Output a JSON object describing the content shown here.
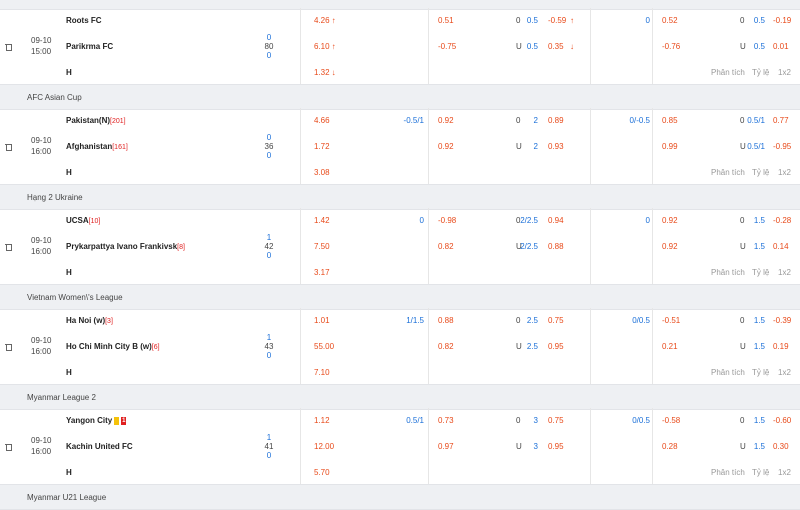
{
  "matches": [
    {
      "league": "",
      "date": "09-10",
      "time": "15:00",
      "home": "Roots FC",
      "home_rank": "",
      "away": "Parikrma FC",
      "away_rank": "",
      "draw": "H",
      "score_top": "0",
      "minute": "80",
      "score_bot": "0",
      "x1": "4.26",
      "x2": "6.10",
      "x3": "1.32",
      "x1_arrow": "↑",
      "x2_arrow": "↑",
      "x3_arrow": "↓",
      "hcap_line": "",
      "hcap1": "0.51",
      "hcap2": "-0.75",
      "ou_h": "0",
      "ou_line_h": "0.5",
      "ou1": "-0.59",
      "ou1_arrow": "↑",
      "ou_a": "U",
      "ou_line_a": "0.5",
      "ou2": "0.35",
      "ou2_arrow": "↓",
      "h1_line": "0",
      "h1a": "0.52",
      "h1b": "-0.76",
      "h1ou_h": "0",
      "h1ou_lh": "0.5",
      "h1ou1": "-0.19",
      "h1ou_a": "U",
      "h1ou_la": "0.5",
      "h1ou2": "0.01",
      "link1": "Phân tích",
      "link2": "Tỷ lệ",
      "link3": "1x2"
    },
    {
      "league": "AFC Asian Cup",
      "date": "09-10",
      "time": "16:00",
      "home": "Pakistan(N)",
      "home_rank": "[201]",
      "away": "Afghanistan",
      "away_rank": "[161]",
      "draw": "H",
      "score_top": "0",
      "minute": "36",
      "score_bot": "0",
      "x1": "4.66",
      "x2": "1.72",
      "x3": "3.08",
      "hcap_line": "-0.5/1",
      "hcap1": "0.92",
      "hcap2": "0.92",
      "ou_h": "0",
      "ou_line_h": "2",
      "ou1": "0.89",
      "ou_a": "U",
      "ou_line_a": "2",
      "ou2": "0.93",
      "h1_line": "0/-0.5",
      "h1a": "0.85",
      "h1b": "0.99",
      "h1ou_h": "0",
      "h1ou_lh": "0.5/1",
      "h1ou1": "0.77",
      "h1ou_a": "U",
      "h1ou_la": "0.5/1",
      "h1ou2": "-0.95",
      "link1": "Phân tích",
      "link2": "Tỷ lệ",
      "link3": "1x2"
    },
    {
      "league": "Hạng 2 Ukraine",
      "date": "09-10",
      "time": "16:00",
      "home": "UCSA",
      "home_rank": "[10]",
      "away": "Prykarpattya Ivano Frankivsk",
      "away_rank": "[8]",
      "draw": "H",
      "score_top": "1",
      "minute": "42",
      "score_bot": "0",
      "x1": "1.42",
      "x2": "7.50",
      "x3": "3.17",
      "hcap_line": "0",
      "hcap1": "-0.98",
      "hcap2": "0.82",
      "ou_h": "0",
      "ou_line_h": "2/2.5",
      "ou1": "0.94",
      "ou_a": "U",
      "ou_line_a": "2/2.5",
      "ou2": "0.88",
      "h1_line": "0",
      "h1a": "0.92",
      "h1b": "0.92",
      "h1ou_h": "0",
      "h1ou_lh": "1.5",
      "h1ou1": "-0.28",
      "h1ou_a": "U",
      "h1ou_la": "1.5",
      "h1ou2": "0.14",
      "link1": "Phân tích",
      "link2": "Tỷ lệ",
      "link3": "1x2"
    },
    {
      "league": "Vietnam Women\\'s League",
      "date": "09-10",
      "time": "16:00",
      "home": "Ha Noi (w)",
      "home_rank": "[3]",
      "away": "Ho Chi Minh City B (w)",
      "away_rank": "[6]",
      "draw": "H",
      "score_top": "1",
      "minute": "43",
      "score_bot": "0",
      "x1": "1.01",
      "x2": "55.00",
      "x3": "7.10",
      "hcap_line": "1/1.5",
      "hcap1": "0.88",
      "hcap2": "0.82",
      "ou_h": "0",
      "ou_line_h": "2.5",
      "ou1": "0.75",
      "ou_a": "U",
      "ou_line_a": "2.5",
      "ou2": "0.95",
      "h1_line": "0/0.5",
      "h1a": "-0.51",
      "h1b": "0.21",
      "h1ou_h": "0",
      "h1ou_lh": "1.5",
      "h1ou1": "-0.39",
      "h1ou_a": "U",
      "h1ou_la": "1.5",
      "h1ou2": "0.19",
      "link1": "Phân tích",
      "link2": "Tỷ lệ",
      "link3": "1x2"
    },
    {
      "league": "Myanmar League 2",
      "date": "09-10",
      "time": "16:00",
      "home": "Yangon City",
      "home_rank": "",
      "home_card": "1",
      "away": "Kachin United FC",
      "away_rank": "",
      "draw": "H",
      "score_top": "1",
      "minute": "41",
      "score_bot": "0",
      "x1": "1.12",
      "x2": "12.00",
      "x3": "5.70",
      "hcap_line": "0.5/1",
      "hcap1": "0.73",
      "hcap2": "0.97",
      "ou_h": "0",
      "ou_line_h": "3",
      "ou1": "0.75",
      "ou_a": "U",
      "ou_line_a": "3",
      "ou2": "0.95",
      "h1_line": "0/0.5",
      "h1a": "-0.58",
      "h1b": "0.28",
      "h1ou_h": "0",
      "h1ou_lh": "1.5",
      "h1ou1": "-0.60",
      "h1ou_a": "U",
      "h1ou_la": "1.5",
      "h1ou2": "0.30",
      "link1": "Phân tích",
      "link2": "Tỷ lệ",
      "link3": "1x2"
    }
  ],
  "next_league": "Myanmar U21 League"
}
